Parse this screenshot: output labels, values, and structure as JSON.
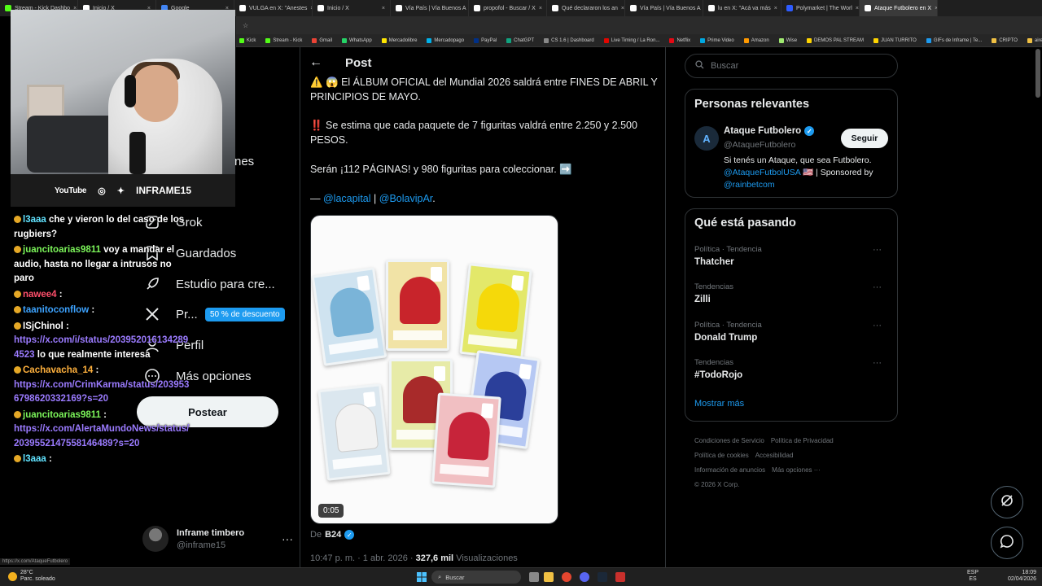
{
  "browser": {
    "tabs": [
      {
        "label": "Stream - Kick Dashbo",
        "color": "#53fc18"
      },
      {
        "label": "Inicio / X",
        "color": "#ffffff"
      },
      {
        "label": "Google",
        "color": "#4285f4"
      },
      {
        "label": "VULGA en X: \"Anestes",
        "color": "#ffffff"
      },
      {
        "label": "Inicio / X",
        "color": "#ffffff"
      },
      {
        "label": "Vía País | Vía Buenos A",
        "color": "#ffffff"
      },
      {
        "label": "propofol - Buscar / X",
        "color": "#ffffff"
      },
      {
        "label": "Qué declararon los an",
        "color": "#ffffff"
      },
      {
        "label": "Vía País | Vía Buenos A",
        "color": "#ffffff"
      },
      {
        "label": "lu en X: \"Acá va más",
        "color": "#ffffff"
      },
      {
        "label": "Polymarket | The Worl",
        "color": "#2e5cff"
      },
      {
        "label": "Ataque Futbolero en X",
        "color": "#ffffff"
      }
    ],
    "bookmarks": [
      "Kick",
      "Stream - Kick",
      "Gmail",
      "WhatsApp",
      "Mercadolibre",
      "Mercadopago",
      "PayPal",
      "ChatGPT",
      "CS 1.6 | Dashboard",
      "Live Timing / La Ron...",
      "Netflix",
      "Prime Video",
      "Amazon",
      "Wise",
      "DEMOS PAL STREAM",
      "JUAN TURRITO",
      "GIFs de Inframe | Te...",
      "CRIPTO",
      "aires"
    ],
    "status_url": "https://x.com/AtaqueFutbolero"
  },
  "stream": {
    "socials": [
      "YouTube",
      "INFRAME15"
    ],
    "chat": [
      {
        "user": "l3aaa",
        "user_color": "#61e3ff",
        "text": "che y vieron lo del caso de los rugbiers?"
      },
      {
        "user": "juancitoarias9811",
        "user_color": "#7cf55a",
        "text": "voy a mandar el audio, hasta no llegar a intrusos no paro"
      },
      {
        "user": "nawee4",
        "user_color": "#ff4f6b",
        "text": ":"
      },
      {
        "user": "taanitoconflow",
        "user_color": "#3da3ff",
        "text": ":"
      },
      {
        "user": "ISjChinol",
        "user_color": "#ffffff",
        "text": ":",
        "link": "https://x.com/i/status/2039520161342894523",
        "after": "lo que realmente interesa"
      },
      {
        "user": "Cachavacha_14",
        "user_color": "#ffb13d",
        "text": ":",
        "link": "https://x.com/CrimKarma/status/2039536798620332169?s=20",
        "after": ""
      },
      {
        "user": "juancitoarias9811",
        "user_color": "#7cf55a",
        "text": ":",
        "link": "https://x.com/AlertaMundoNews/status/2039552147558146489?s=20",
        "after": ""
      },
      {
        "user": "l3aaa",
        "user_color": "#61e3ff",
        "text": ":"
      }
    ]
  },
  "nav": {
    "partial_item": "nes",
    "items": [
      "Grok",
      "Guardados",
      "Estudio para cre...",
      "Pr...",
      "Perfil",
      "Más opciones"
    ],
    "promo": "50 % de descuento",
    "post_button": "Postear",
    "profile_name": "Inframe timbero",
    "profile_handle": "@inframe15"
  },
  "post": {
    "header": "Post",
    "line1": "⚠️ 😱 El ÁLBUM OFICIAL del Mundial 2026 saldrá entre FINES DE ABRIL Y PRINCIPIOS DE MAYO.",
    "line2": "‼️ Se estima que cada paquete de 7 figuritas valdrá entre 2.250 y 2.500 PESOS.",
    "line3": "Serán ¡112 PÁGINAS! y 980 figuritas para coleccionar. ➡️",
    "credit_prefix": "—",
    "credit_1": "@lacapital",
    "credit_sep": "|",
    "credit_2": "@BolavipAr",
    "credit_end": ".",
    "video_time": "0:05",
    "from_label": "De",
    "from_account": "B24",
    "timestamp": "10:47 p. m. · 1 abr. 2026 ·",
    "views_count": "327,6 mil",
    "views_label": "Visualizaciones"
  },
  "right": {
    "search_placeholder": "Buscar",
    "relevant_title": "Personas relevantes",
    "account_name": "Ataque Futbolero",
    "account_handle": "@AtaqueFutbolero",
    "follow_label": "Seguir",
    "bio_1": "Si tenés un Ataque, que sea Futbolero.",
    "bio_2a": "@AtaqueFutbolUSA",
    "bio_2b": "🇺🇸 | Sponsored by",
    "bio_3": "@rainbetcom",
    "trends_title": "Qué está pasando",
    "trends": [
      {
        "category": "Política · Tendencia",
        "title": "Thatcher"
      },
      {
        "category": "Tendencias",
        "title": "Zilli"
      },
      {
        "category": "Política · Tendencia",
        "title": "Donald Trump"
      },
      {
        "category": "Tendencias",
        "title": "#TodoRojo"
      }
    ],
    "show_more": "Mostrar más",
    "footer": [
      "Condiciones de Servicio",
      "Política de Privacidad",
      "Política de cookies",
      "Accesibilidad",
      "Información de anuncios",
      "Más opciones ···",
      "© 2026 X Corp."
    ]
  },
  "taskbar": {
    "weather_temp": "28°C",
    "weather_desc": "Parc. soleado",
    "search_label": "Buscar",
    "lang": "ESP",
    "lang2": "ES",
    "time": "18:09",
    "date": "02/04/2026"
  },
  "colors": {
    "accent": "#1d9bf0",
    "bg": "#000000",
    "border": "#2f3336"
  }
}
